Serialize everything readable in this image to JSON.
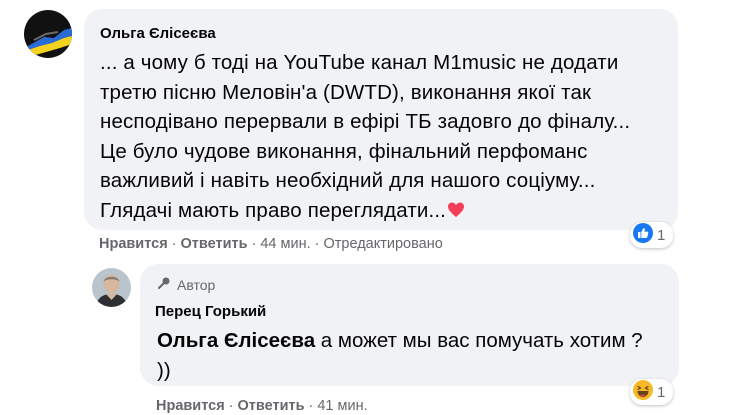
{
  "comment": {
    "author": "Ольга Єлісеєва",
    "lines": [
      "... а чому б тоді на YouTube канал M1music не додати",
      "третю пісню Меловін'а (DWTD), виконання якої так",
      "несподівано перервали в ефірі ТБ задовго до фіналу...",
      "Це було чудове виконання, фінальний перфоманс",
      "важливий і навіть необхідний для нашого соціуму...",
      "Глядачі мають право переглядати..."
    ],
    "like_label": "Нравится",
    "reply_label": "Ответить",
    "time": "44 мин.",
    "edited": "Отредактировано",
    "reaction_icon": "like-icon",
    "reaction_count": "1"
  },
  "reply": {
    "badge": "Автор",
    "author": "Перец Горький",
    "mention": "Ольга Єлісеєва",
    "line1_rest": " а может мы вас помучать хотим ?",
    "line2": "))",
    "like_label": "Нравится",
    "reply_label": "Ответить",
    "time": "41 мин.",
    "reaction_icon": "haha-icon",
    "reaction_count": "1"
  },
  "colors": {
    "bubble": "#f0f2f5",
    "secondary_text": "#65676b",
    "like_blue": "#1877f2",
    "haha_yellow": "#f7b928",
    "heart_red": "#f33e58"
  }
}
